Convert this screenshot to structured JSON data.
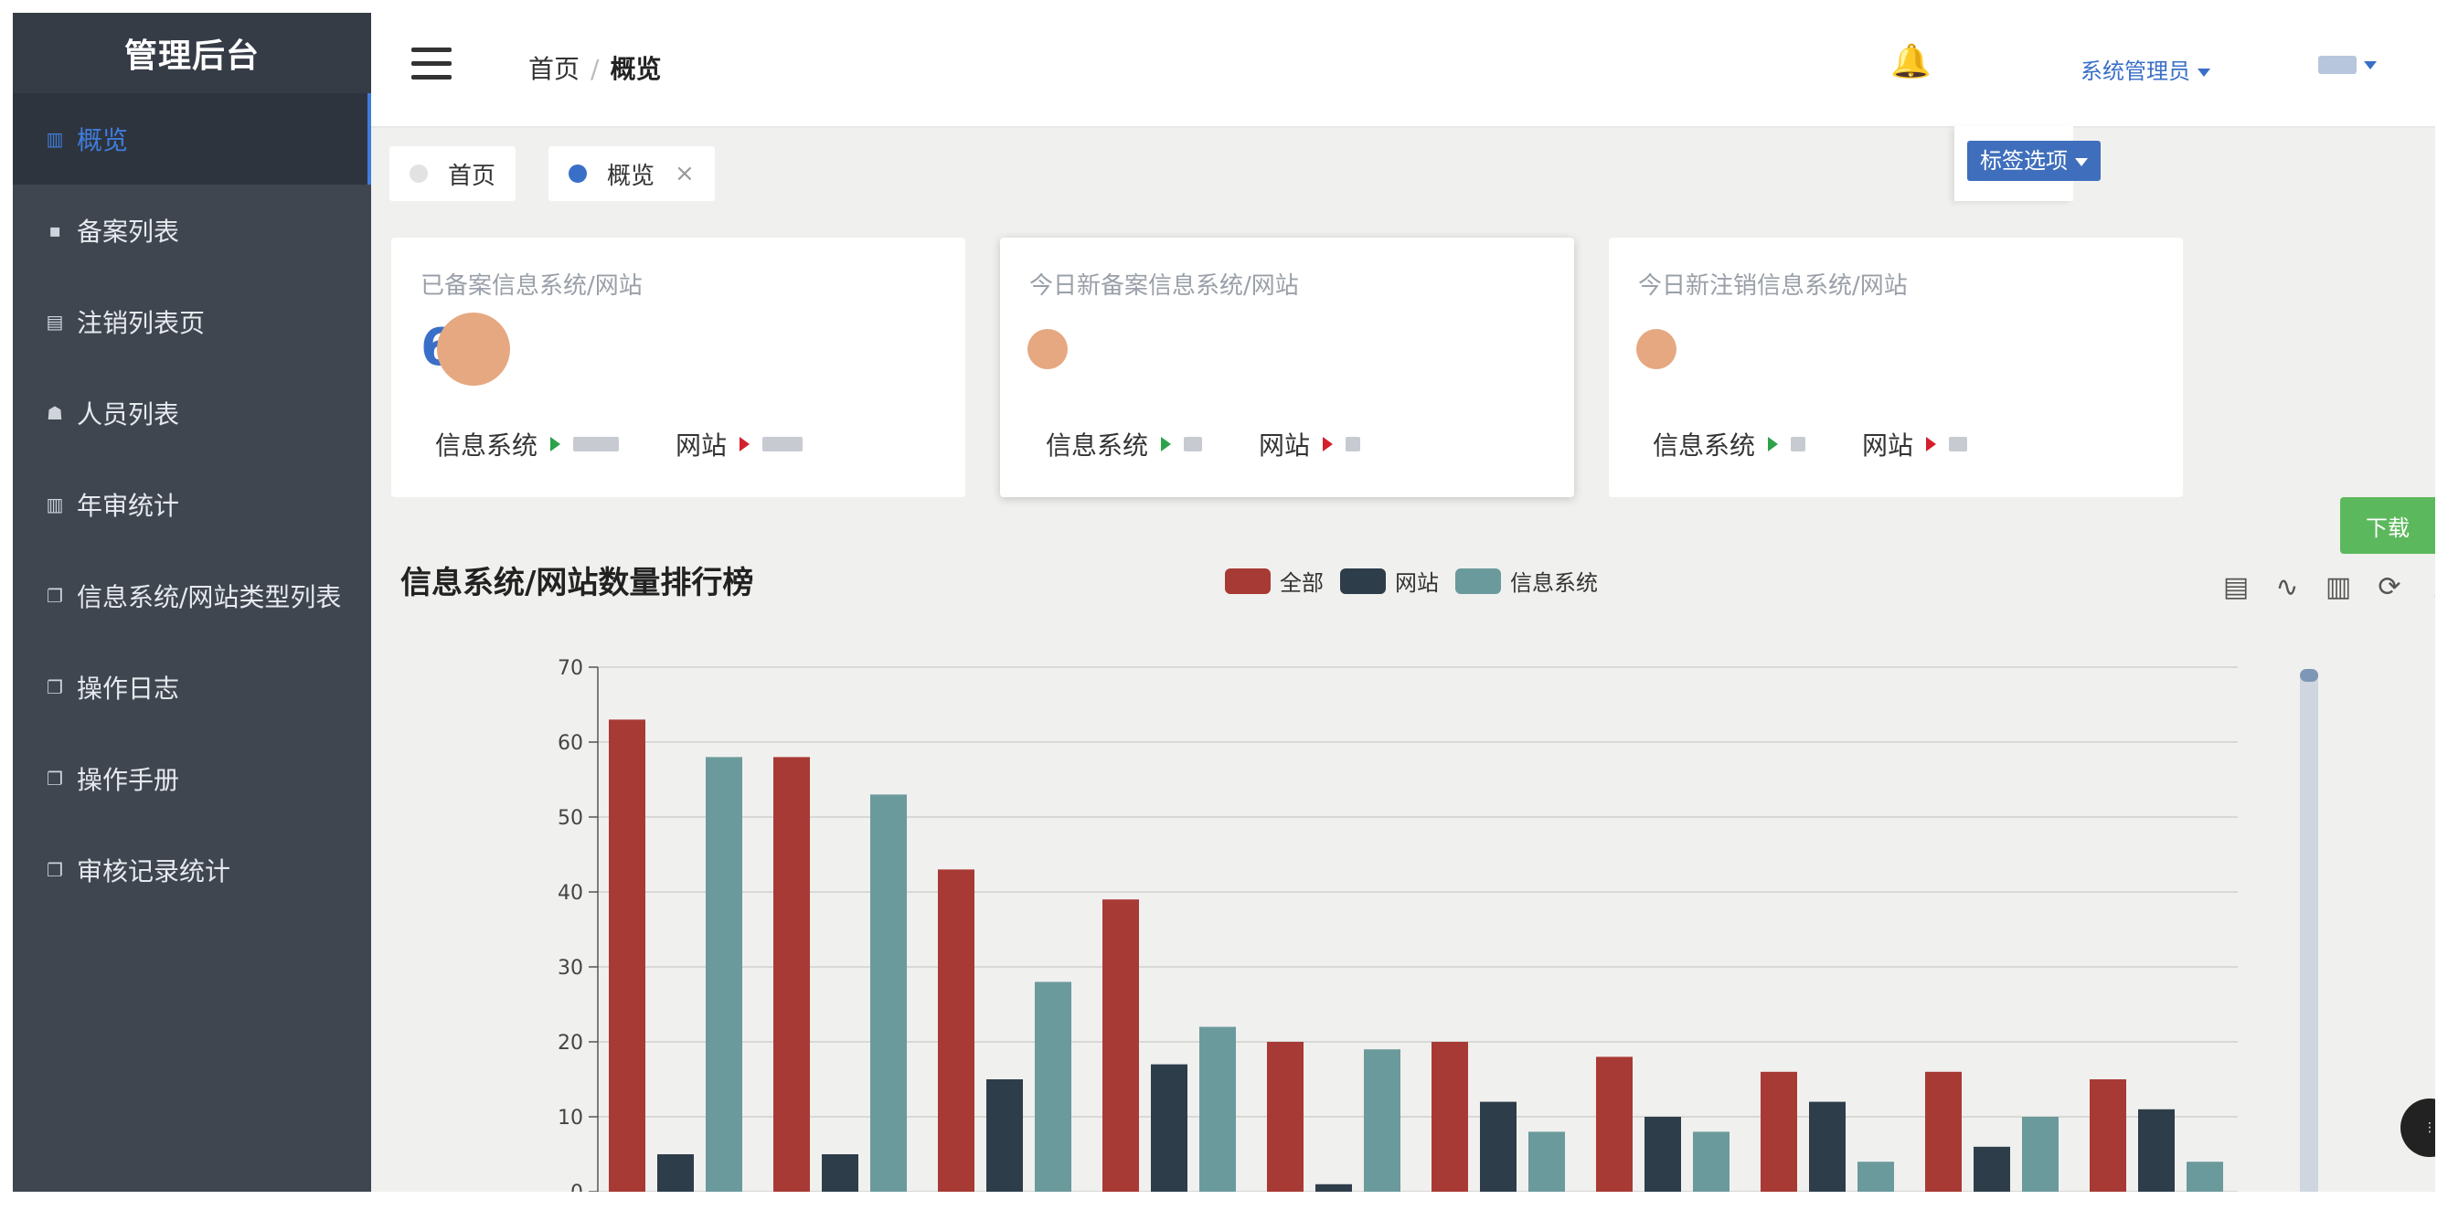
{
  "sidebar": {
    "brand": "管理后台",
    "items": [
      {
        "label": "概览",
        "icon": "bar-chart-icon",
        "glyph": "▥",
        "active": true
      },
      {
        "label": "备案列表",
        "icon": "document-icon",
        "glyph": "▪",
        "active": false
      },
      {
        "label": "注销列表页",
        "icon": "clipboard-icon",
        "glyph": "▤",
        "active": false
      },
      {
        "label": "人员列表",
        "icon": "users-icon",
        "glyph": "☗",
        "active": false
      },
      {
        "label": "年审统计",
        "icon": "bar-chart-icon",
        "glyph": "▥",
        "active": false
      },
      {
        "label": "信息系统/网站类型列表",
        "icon": "copy-icon",
        "glyph": "❐",
        "active": false
      },
      {
        "label": "操作日志",
        "icon": "copy-icon",
        "glyph": "❐",
        "active": false
      },
      {
        "label": "操作手册",
        "icon": "copy-icon",
        "glyph": "❐",
        "active": false
      },
      {
        "label": "审核记录统计",
        "icon": "copy-icon",
        "glyph": "❐",
        "active": false
      }
    ]
  },
  "header": {
    "breadcrumb_home": "首页",
    "breadcrumb_sep": "/",
    "breadcrumb_current": "概览",
    "user_label": "系统管理员"
  },
  "tabs": {
    "items": [
      {
        "label": "首页",
        "dot_color": "#e2e2e2",
        "closable": false
      },
      {
        "label": "概览",
        "dot_color": "#3a6fc7",
        "closable": true
      }
    ],
    "close_glyph": "×",
    "tag_options": "标签选项"
  },
  "cards": [
    {
      "title": "已备案信息系统/网站",
      "number": "6",
      "sys_label": "信息系统",
      "site_label": "网站"
    },
    {
      "title": "今日新备案信息系统/网站",
      "number": "",
      "sys_label": "信息系统",
      "site_label": "网站"
    },
    {
      "title": "今日新注销信息系统/网站",
      "number": "",
      "sys_label": "信息系统",
      "site_label": "网站"
    }
  ],
  "download_label": "下载",
  "colors": {
    "all": "#a83a35",
    "site": "#2e3d4a",
    "system": "#6b9a9c",
    "accent": "#3a6fc7"
  },
  "chart_data": {
    "type": "bar",
    "title": "信息系统/网站数量排行榜",
    "ylim": [
      0,
      70
    ],
    "yticks": [
      0,
      10,
      20,
      30,
      40,
      50,
      60,
      70
    ],
    "categories": [
      "",
      "",
      "",
      "",
      "",
      "",
      "",
      "",
      "",
      "",
      ""
    ],
    "series": [
      {
        "name": "全部",
        "color": "#a83a35",
        "values": [
          63,
          58,
          43,
          39,
          20,
          20,
          18,
          16,
          16,
          15
        ]
      },
      {
        "name": "网站",
        "color": "#2e3d4a",
        "values": [
          5,
          5,
          15,
          17,
          1,
          12,
          10,
          12,
          6,
          11
        ]
      },
      {
        "name": "信息系统",
        "color": "#6b9a9c",
        "values": [
          58,
          53,
          28,
          22,
          19,
          8,
          8,
          4,
          10,
          4
        ]
      }
    ],
    "grid": true,
    "legend_position": "top-center"
  },
  "toolbox": [
    {
      "name": "data-view-icon",
      "glyph": "▤"
    },
    {
      "name": "line-chart-icon",
      "glyph": "∿"
    },
    {
      "name": "bar-chart-icon",
      "glyph": "▥"
    },
    {
      "name": "refresh-icon",
      "glyph": "⟳"
    },
    {
      "name": "download-icon",
      "glyph": "⤓"
    }
  ]
}
